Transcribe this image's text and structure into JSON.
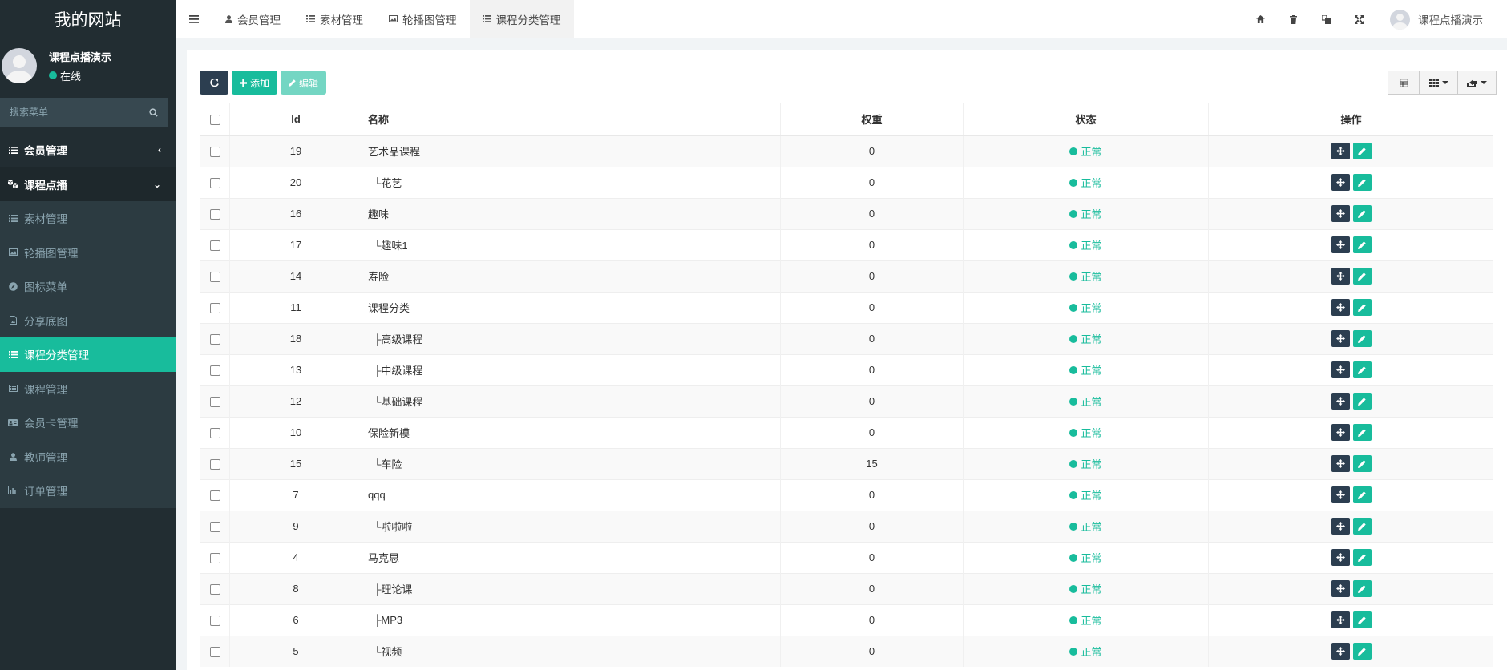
{
  "sidebar": {
    "logo": "我的网站",
    "user": {
      "name": "课程点播演示",
      "status": "在线"
    },
    "search_placeholder": "搜索菜单",
    "menu": [
      {
        "label": "会员管理",
        "icon": "list-icon",
        "type": "top",
        "arrow": "‹"
      },
      {
        "label": "课程点播",
        "icon": "cubes-icon",
        "type": "top open",
        "arrow": "⌄"
      },
      {
        "label": "素材管理",
        "icon": "list-icon",
        "type": "sub"
      },
      {
        "label": "轮播图管理",
        "icon": "image-icon",
        "type": "sub"
      },
      {
        "label": "图标菜单",
        "icon": "compass-icon",
        "type": "sub"
      },
      {
        "label": "分享底图",
        "icon": "file-image-icon",
        "type": "sub"
      },
      {
        "label": "课程分类管理",
        "icon": "list-icon",
        "type": "sub active"
      },
      {
        "label": "课程管理",
        "icon": "list-alt-icon",
        "type": "sub"
      },
      {
        "label": "会员卡管理",
        "icon": "id-card-icon",
        "type": "sub"
      },
      {
        "label": "教师管理",
        "icon": "user-icon",
        "type": "sub"
      },
      {
        "label": "订单管理",
        "icon": "bar-chart-icon",
        "type": "sub"
      }
    ]
  },
  "topbar": {
    "tabs": [
      {
        "label": "会员管理",
        "icon": "user-icon"
      },
      {
        "label": "素材管理",
        "icon": "list-icon"
      },
      {
        "label": "轮播图管理",
        "icon": "image-icon"
      },
      {
        "label": "课程分类管理",
        "icon": "list-icon",
        "active": true
      }
    ],
    "right_icons": [
      "home-icon",
      "trash-icon",
      "translate-icon",
      "fullscreen-icon"
    ],
    "user_name": "课程点播演示"
  },
  "toolbar": {
    "add_label": "添加",
    "edit_label": "编辑"
  },
  "table": {
    "headers": {
      "id": "Id",
      "name": "名称",
      "weight": "权重",
      "status": "状态",
      "ops": "操作"
    },
    "rows": [
      {
        "id": "19",
        "name": "艺术品课程",
        "weight": "0",
        "status": "正常"
      },
      {
        "id": "20",
        "name": "  └花艺",
        "weight": "0",
        "status": "正常"
      },
      {
        "id": "16",
        "name": "趣味",
        "weight": "0",
        "status": "正常"
      },
      {
        "id": "17",
        "name": "  └趣味1",
        "weight": "0",
        "status": "正常"
      },
      {
        "id": "14",
        "name": "寿险",
        "weight": "0",
        "status": "正常"
      },
      {
        "id": "11",
        "name": "课程分类",
        "weight": "0",
        "status": "正常"
      },
      {
        "id": "18",
        "name": "  ├高级课程",
        "weight": "0",
        "status": "正常"
      },
      {
        "id": "13",
        "name": "  ├中级课程",
        "weight": "0",
        "status": "正常"
      },
      {
        "id": "12",
        "name": "  └基础课程",
        "weight": "0",
        "status": "正常"
      },
      {
        "id": "10",
        "name": "保险新模",
        "weight": "0",
        "status": "正常"
      },
      {
        "id": "15",
        "name": "  └车险",
        "weight": "15",
        "status": "正常"
      },
      {
        "id": "7",
        "name": "qqq",
        "weight": "0",
        "status": "正常"
      },
      {
        "id": "9",
        "name": "  └啦啦啦",
        "weight": "0",
        "status": "正常"
      },
      {
        "id": "4",
        "name": "马克思",
        "weight": "0",
        "status": "正常"
      },
      {
        "id": "8",
        "name": "  ├理论课",
        "weight": "0",
        "status": "正常"
      },
      {
        "id": "6",
        "name": "  ├MP3",
        "weight": "0",
        "status": "正常"
      },
      {
        "id": "5",
        "name": "  └视频",
        "weight": "0",
        "status": "正常"
      }
    ]
  },
  "colors": {
    "accent": "#18bc9c",
    "sidebar_bg": "#222d32",
    "dark_btn": "#2c3e50"
  }
}
